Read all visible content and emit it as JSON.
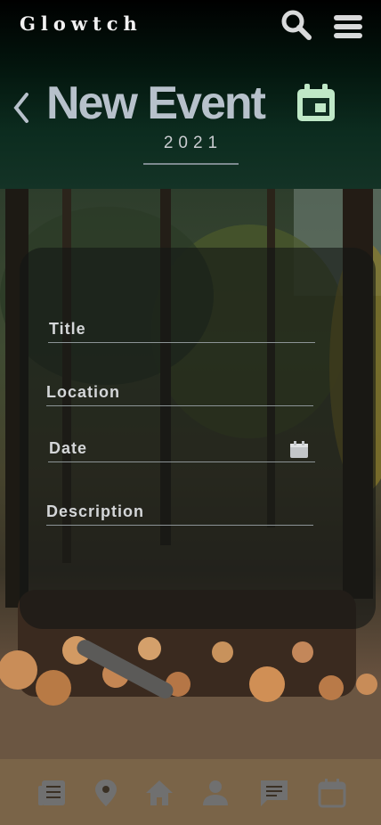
{
  "app": {
    "brand": "Glowtch"
  },
  "header": {
    "title": "New Event",
    "year": "2021"
  },
  "form": {
    "title_label": "Title",
    "location_label": "Location",
    "date_label": "Date",
    "description_label": "Description"
  },
  "colors": {
    "accent": "#bfe8c7",
    "header_bg": "#0c2c1f",
    "title_text": "#b7c1cb"
  },
  "icons": {
    "search": "search-icon",
    "menu": "menu-icon",
    "back": "chevron-left-icon",
    "calendar": "calendar-icon",
    "nav": [
      "news-icon",
      "location-pin-icon",
      "home-icon",
      "person-icon",
      "chat-icon",
      "calendar-icon"
    ]
  }
}
